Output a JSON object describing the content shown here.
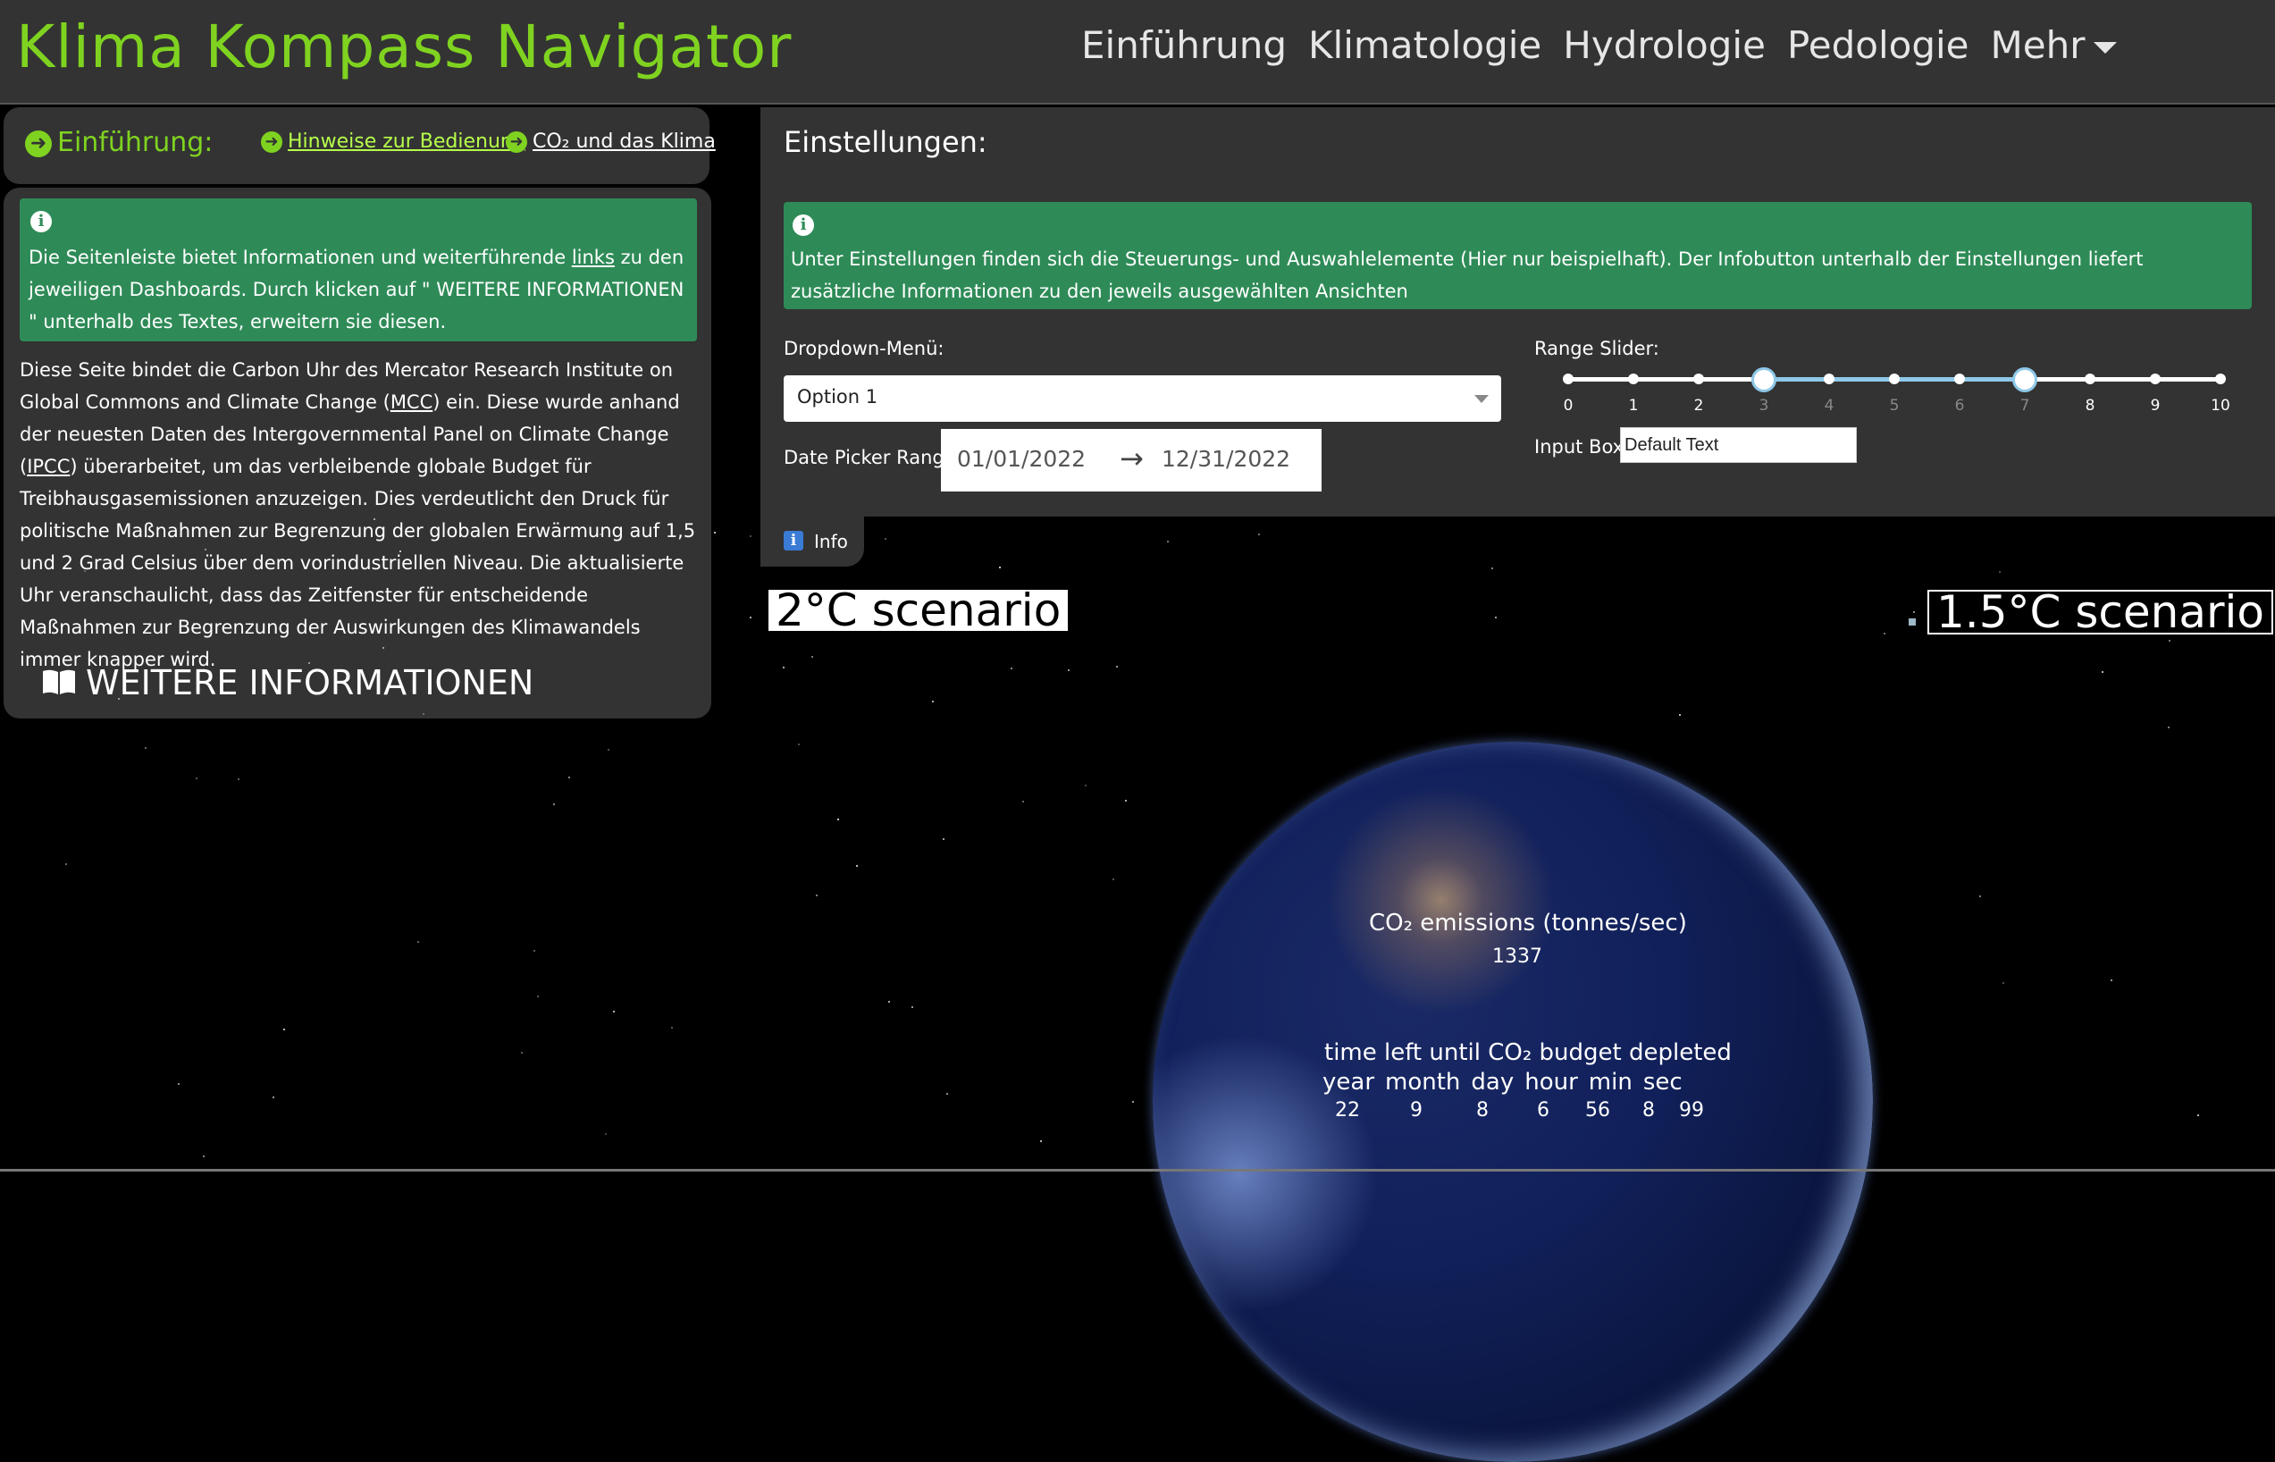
{
  "app": {
    "title": "Klima Kompass Navigator",
    "brand_color": "#7fd320"
  },
  "nav": {
    "items": [
      {
        "label": "Einführung"
      },
      {
        "label": "Klimatologie"
      },
      {
        "label": "Hydrologie"
      },
      {
        "label": "Pedologie"
      },
      {
        "label": "Mehr"
      }
    ]
  },
  "sidebar": {
    "tabs": [
      {
        "label": "Einführung:",
        "icon": "arrow-circle-right-icon"
      },
      {
        "label": "Hinweise zur Bedienung",
        "icon": "arrow-circle-right-icon"
      },
      {
        "label": "CO₂ und das Klima",
        "icon": "arrow-circle-right-icon"
      }
    ],
    "info": {
      "text_before_link": "Die Seitenleiste bietet Informationen und weiterführende ",
      "link": "links",
      "text_after_link": " zu den jeweiligen Dashboards. Durch klicken auf \" WEITERE INFORMATIONEN \" unterhalb des Textes, erweitern sie diesen."
    },
    "body": {
      "p1": "Diese Seite bindet die Carbon Uhr des Mercator Research Institute on Global Commons and Climate Change (",
      "mcc": "MCC",
      "p2": ") ein. Diese wurde anhand der neuesten Daten des Intergovernmental Panel on Climate Change (",
      "ipcc": "IPCC",
      "p3": ") überarbeitet, um das verbleibende globale Budget für Treibhausgasemissionen anzuzeigen. Dies verdeutlicht den Druck für politische Maßnahmen zur Begrenzung der globalen Erwärmung auf 1,5 und 2 Grad Celsius über dem vorindustriellen Niveau. Die aktualisierte Uhr veranschaulicht, dass das Zeitfenster für entscheidende Maßnahmen zur Begrenzung der Auswirkungen des Klimawandels immer knapper wird."
    },
    "more_info": "WEITERE INFORMATIONEN"
  },
  "settings": {
    "title": "Einstellungen:",
    "info_text": "Unter Einstellungen finden sich die Steuerungs- und Auswahlelemente (Hier nur beispielhaft). Der Infobutton unterhalb der Einstellungen liefert zusätzliche Informationen zu den jeweils ausgewählten Ansichten",
    "dropdown_label": "Dropdown-Menü:",
    "dropdown_value": "Option 1",
    "date_label": "Date Picker Range:",
    "date_start": "01/01/2022",
    "date_arrow": "→",
    "date_end": "12/31/2022",
    "slider_label": "Range Slider:",
    "slider_marks": [
      "0",
      "1",
      "2",
      "3",
      "4",
      "5",
      "6",
      "7",
      "8",
      "9",
      "10"
    ],
    "slider_min": 0,
    "slider_max": 10,
    "slider_value": [
      3,
      7
    ],
    "input_label": "Input Box:",
    "input_value": "Default Text",
    "info_button": "Info"
  },
  "carbon_clock": {
    "scenario_2": "2°C scenario",
    "scenario_15": "1.5°C scenario",
    "emissions_label": "CO₂ emissions (tonnes/sec)",
    "emissions_value": "1337",
    "time_left_label": "time left until CO₂ budget depleted",
    "units": [
      "year",
      "month",
      "day",
      "hour",
      "min",
      "sec"
    ],
    "values": [
      "22",
      "9",
      "8",
      "6",
      "56",
      "8",
      "99"
    ]
  }
}
